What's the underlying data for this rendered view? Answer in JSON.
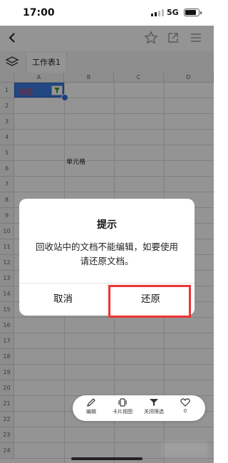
{
  "status_bar": {
    "time": "17:00",
    "network": "5G"
  },
  "sheet": {
    "tab_name": "工作表1",
    "columns": [
      "A",
      "B",
      "C",
      "D"
    ],
    "rows": [
      "1",
      "2",
      "3",
      "4",
      "5",
      "6",
      "7",
      "8",
      "9",
      "10",
      "11",
      "12",
      "13",
      "14",
      "15",
      "16",
      "17",
      "18",
      "19",
      "20",
      "21",
      "22",
      "23",
      "24"
    ],
    "selected_cell_text": "筛选",
    "cell_text": "单元格"
  },
  "dialog": {
    "title": "提示",
    "message": "回收站中的文档不能编辑，如要使用请还原文档。",
    "cancel_label": "取消",
    "restore_label": "还原"
  },
  "toolbar": {
    "edit_label": "编辑",
    "card_view_label": "卡片视图",
    "close_filter_label": "关闭筛选",
    "like_count": "0"
  },
  "colors": {
    "accent": "#3b7be0",
    "highlight": "#e33333"
  }
}
